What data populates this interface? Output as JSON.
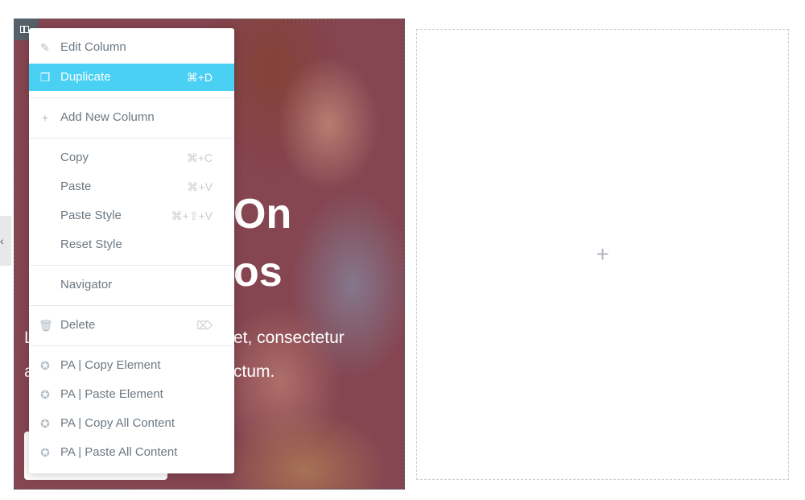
{
  "background": {
    "heading_fragments": [
      "On",
      "os"
    ],
    "paragraph_fragments": [
      "et, consectetur",
      "ctum."
    ],
    "left_fragments": [
      "L",
      "a"
    ]
  },
  "side_tab": {
    "icon": "chevron-left-icon",
    "glyph": "‹"
  },
  "context_menu": {
    "accent": "#49d0f3",
    "items": [
      {
        "label": "Edit Column",
        "icon": "pencil-icon",
        "glyph": "✎",
        "shortcut": ""
      },
      {
        "label": "Duplicate",
        "icon": "duplicate-icon",
        "glyph": "❐",
        "shortcut": "⌘+D"
      },
      {
        "label": "Add New Column",
        "icon": "plus-icon",
        "glyph": "+",
        "shortcut": ""
      },
      {
        "label": "Copy",
        "shortcut": "⌘+C"
      },
      {
        "label": "Paste",
        "shortcut": "⌘+V"
      },
      {
        "label": "Paste Style",
        "shortcut": "⌘+⇧+V"
      },
      {
        "label": "Reset Style",
        "shortcut": ""
      },
      {
        "label": "Navigator",
        "shortcut": ""
      },
      {
        "label": "Delete",
        "icon": "trash-icon",
        "glyph": "🗑",
        "shortcut": "⌦"
      },
      {
        "label": "PA | Copy Element",
        "icon": "premium-addons-icon",
        "glyph": "✪"
      },
      {
        "label": "PA | Paste Element",
        "icon": "premium-addons-icon",
        "glyph": "✪"
      },
      {
        "label": "PA | Copy All Content",
        "icon": "premium-addons-icon",
        "glyph": "✪"
      },
      {
        "label": "PA | Paste All Content",
        "icon": "premium-addons-icon",
        "glyph": "✪"
      }
    ]
  },
  "empty_column": {
    "add_glyph": "+"
  }
}
